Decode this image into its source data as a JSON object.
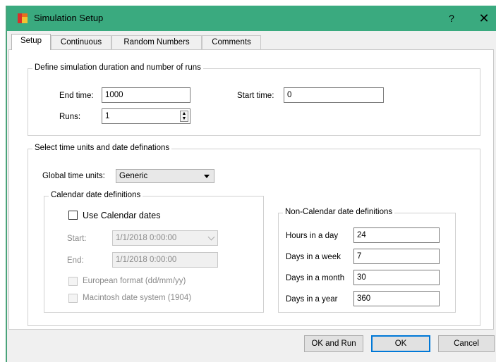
{
  "window": {
    "title": "Simulation Setup",
    "help_label": "?",
    "close_label": "✕"
  },
  "tabs": [
    {
      "label": "Setup",
      "active": true
    },
    {
      "label": "Continuous",
      "active": false
    },
    {
      "label": "Random Numbers",
      "active": false
    },
    {
      "label": "Comments",
      "active": false
    }
  ],
  "duration": {
    "title": "Define simulation duration and number of runs",
    "end_time_label": "End time:",
    "end_time_value": "1000",
    "start_time_label": "Start time:",
    "start_time_value": "0",
    "runs_label": "Runs:",
    "runs_value": "1"
  },
  "time_units": {
    "title": "Select time units and date definations",
    "global_label": "Global time units:",
    "global_value": "Generic"
  },
  "calendar": {
    "title": "Calendar date definitions",
    "use_label": "Use Calendar dates",
    "start_label": "Start:",
    "start_value": "1/1/2018 0:00:00",
    "end_label": "End:",
    "end_value": "1/1/2018 0:00:00",
    "european_label": "European format (dd/mm/yy)",
    "mac_label": "Macintosh date system (1904)"
  },
  "noncalendar": {
    "title": "Non-Calendar date definitions",
    "hours_label": "Hours in a day",
    "hours_value": "24",
    "week_label": "Days in a week",
    "week_value": "7",
    "month_label": "Days in a month",
    "month_value": "30",
    "year_label": "Days in a year",
    "year_value": "360"
  },
  "buttons": {
    "ok_run": "OK and Run",
    "ok": "OK",
    "cancel": "Cancel"
  },
  "colors": {
    "titlebar": "#3aaa7f",
    "default_button_border": "#0078d7"
  }
}
